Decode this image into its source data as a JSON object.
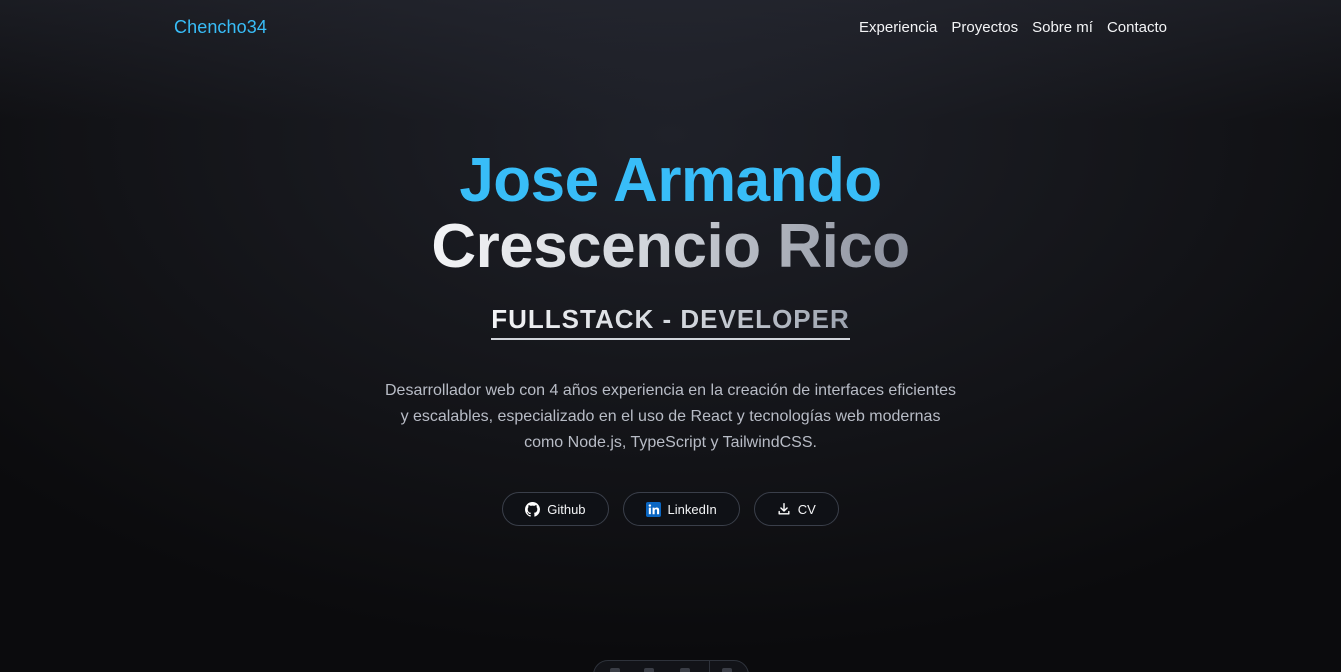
{
  "header": {
    "logo": "Chencho34",
    "nav": [
      "Experiencia",
      "Proyectos",
      "Sobre mí",
      "Contacto"
    ]
  },
  "hero": {
    "name_first": "Jose Armando",
    "name_last": "Crescencio Rico",
    "role": "FULLSTACK - DEVELOPER",
    "description": "Desarrollador web con 4 años experiencia en la creación de interfaces eficientes y escalables, especializado en el uso de React y tecnologías web modernas como Node.js, TypeScript y TailwindCSS."
  },
  "buttons": [
    {
      "label": "Github",
      "icon": "github-icon"
    },
    {
      "label": "LinkedIn",
      "icon": "linkedin-icon"
    },
    {
      "label": "CV",
      "icon": "download-icon"
    }
  ],
  "colors": {
    "accent": "#38bdf8",
    "background": "#0b0b0d",
    "linkedin": "#0a66c2"
  }
}
